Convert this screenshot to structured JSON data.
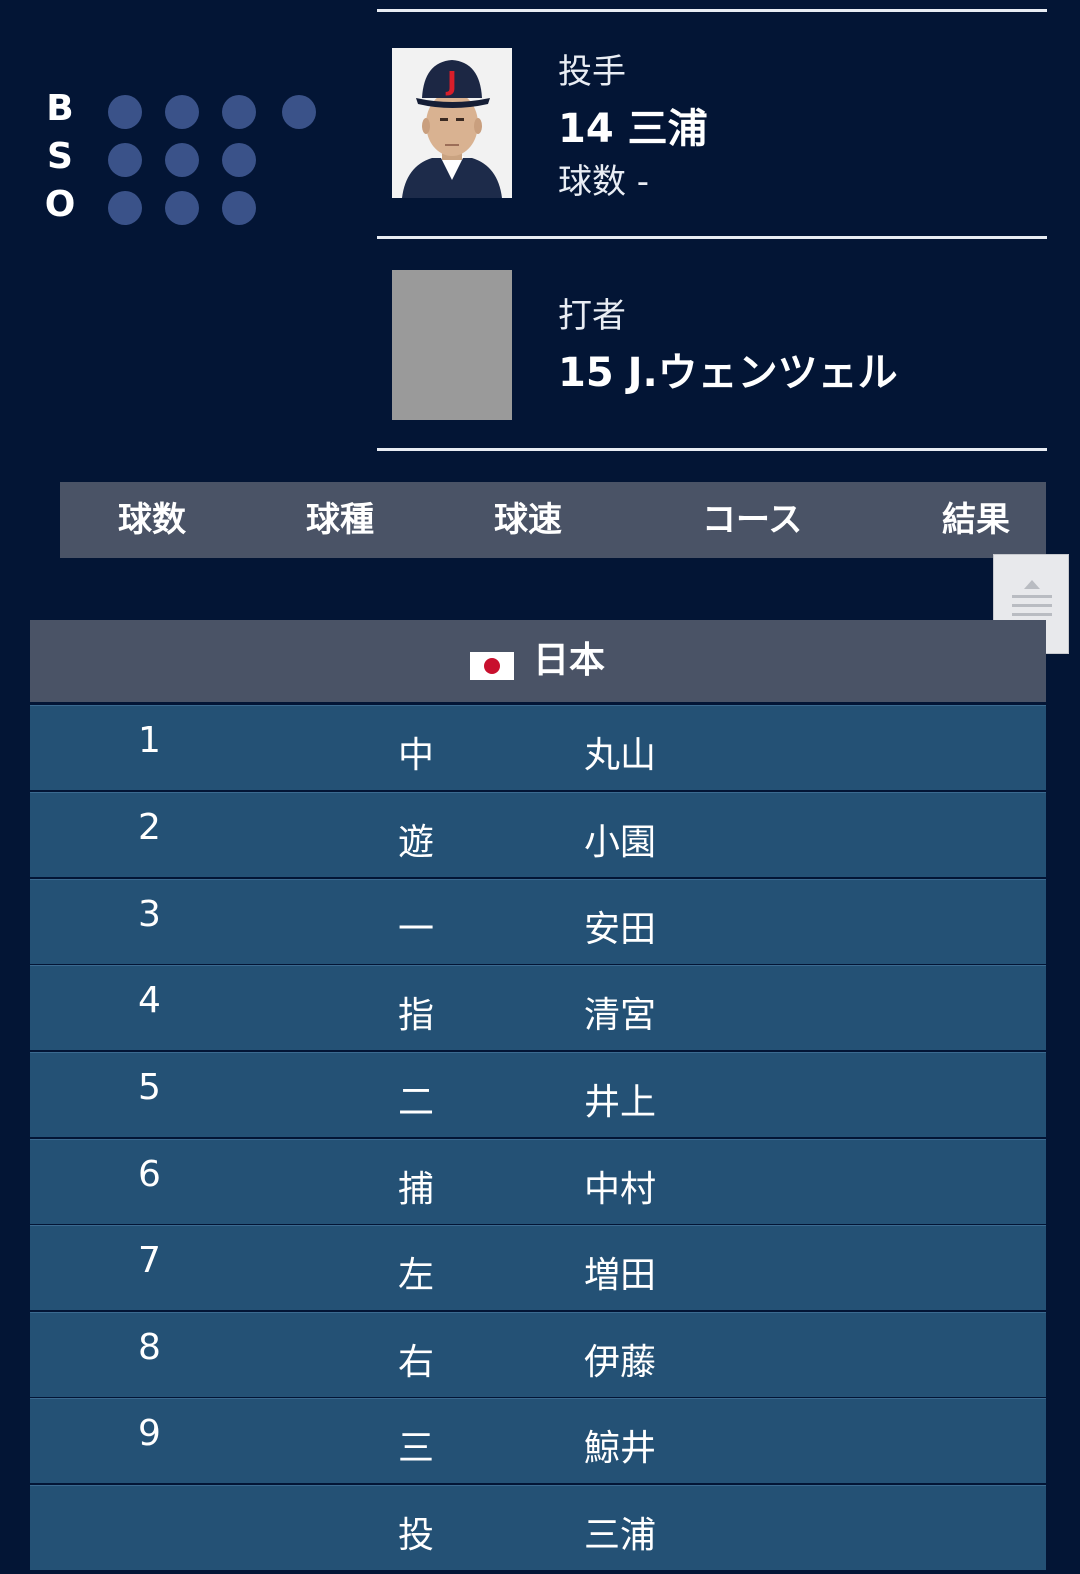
{
  "count_labels": [
    "B",
    "S",
    "O"
  ],
  "pitcher": {
    "role": "投手",
    "name": "14 三浦",
    "pitch_count": "球数 -",
    "cap_letter": "J"
  },
  "batter": {
    "role": "打者",
    "name": "15 J.ウェンツェル"
  },
  "pitch_table": {
    "headers": [
      "球数",
      "球種",
      "球速",
      "コース",
      "結果"
    ]
  },
  "team": {
    "name": "日本"
  },
  "lineup": [
    {
      "order": "1",
      "position": "中",
      "name": "丸山"
    },
    {
      "order": "2",
      "position": "遊",
      "name": "小園"
    },
    {
      "order": "3",
      "position": "一",
      "name": "安田"
    },
    {
      "order": "4",
      "position": "指",
      "name": "清宮"
    },
    {
      "order": "5",
      "position": "二",
      "name": "井上"
    },
    {
      "order": "6",
      "position": "捕",
      "name": "中村"
    },
    {
      "order": "7",
      "position": "左",
      "name": "増田"
    },
    {
      "order": "8",
      "position": "右",
      "name": "伊藤"
    },
    {
      "order": "9",
      "position": "三",
      "name": "鯨井"
    },
    {
      "order": "",
      "position": "投",
      "name": "三浦"
    }
  ],
  "colors": {
    "background": "#031535",
    "indicator_dot": "#3a5289",
    "header_bar": "#4a5366",
    "row": "#245175",
    "flag_red": "#c8102e"
  },
  "icons": {
    "scroll_handle": "scroll-handle-icon",
    "flag": "japan-flag-icon"
  }
}
